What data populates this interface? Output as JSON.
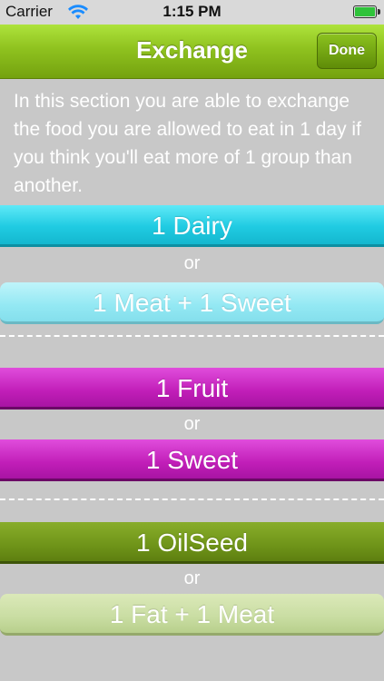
{
  "status_bar": {
    "carrier": "Carrier",
    "time": "1:15 PM",
    "wifi_icon": "wifi-icon",
    "battery_icon": "battery-icon"
  },
  "nav": {
    "title": "Exchange",
    "done_label": "Done"
  },
  "intro_text": "In this section you are able to exchange the food you are allowed to eat in 1 day if you think you'll eat more of 1 group than another.",
  "groups": [
    {
      "first": "1 Dairy",
      "or": "or",
      "second": "1 Meat + 1 Sweet"
    },
    {
      "first": "1 Fruit",
      "or": "or",
      "second": "1 Sweet"
    },
    {
      "first": "1 OilSeed",
      "or": "or",
      "second": "1 Fat + 1 Meat"
    }
  ],
  "colors": {
    "nav_green": "#8fc21f",
    "cyan": "#20cbe2",
    "cyan_light": "#93e8f3",
    "magenta": "#c11eb8",
    "olive": "#6f9419",
    "olive_light": "#c9dda2",
    "background": "#c8c8c8"
  }
}
